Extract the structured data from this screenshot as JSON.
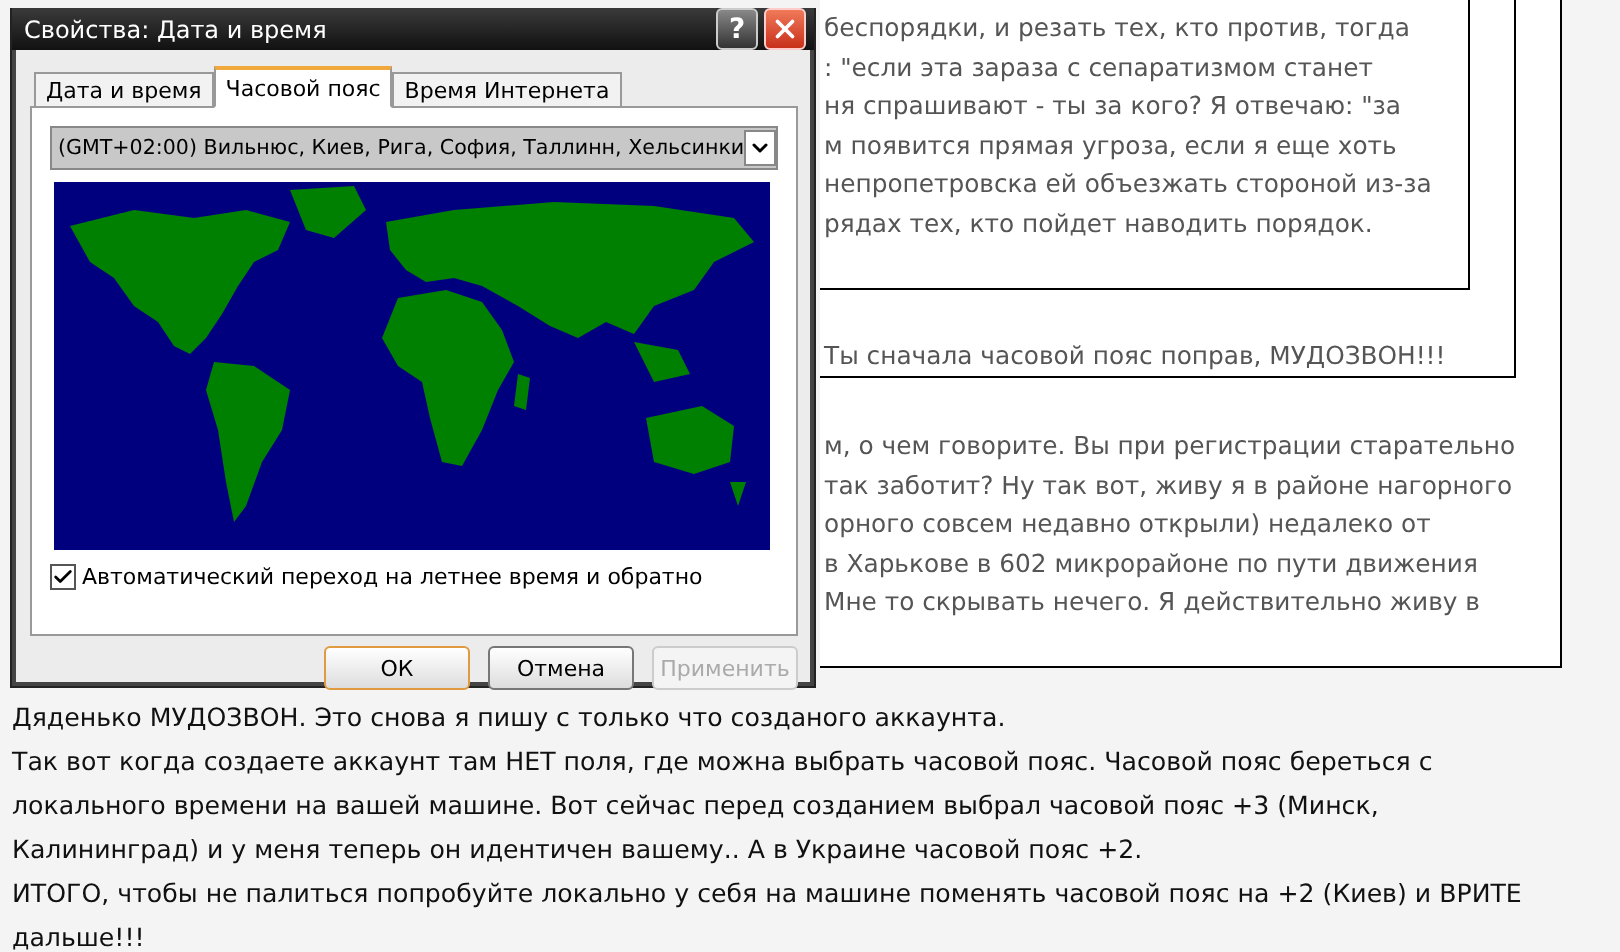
{
  "dialog": {
    "title": "Свойства: Дата и время",
    "help_button": "?",
    "tabs": [
      {
        "label": "Дата и время",
        "selected": false
      },
      {
        "label": "Часовой пояс",
        "selected": true
      },
      {
        "label": "Время Интернета",
        "selected": false
      }
    ],
    "timezone": "(GMT+02:00) Вильнюс, Киев, Рига, София, Таллинн, Хельсинки",
    "dst_checkbox": {
      "label": "Автоматический переход на летнее время и обратно",
      "checked": true
    },
    "buttons": [
      {
        "label": "ОК",
        "kind": "default",
        "disabled": false
      },
      {
        "label": "Отмена",
        "kind": "normal",
        "disabled": false
      },
      {
        "label": "Применить",
        "kind": "normal",
        "disabled": true
      }
    ]
  },
  "quote": {
    "inner_lines": [
      "беспорядки, и резать тех, кто против, тогда",
      ": \"если эта зараза с сепаратизмом станет",
      "ня спрашивают - ты за кого? Я отвечаю: \"за",
      "м появится прямая угроза, если я еще хоть",
      "непропетровска ей объезжать стороной из-за",
      "рядах тех, кто пойдет наводить порядок."
    ],
    "reply": "Ты сначала часовой пояс поправ, МУДОЗВОН!!!",
    "outer_lines": [
      "м, о чем говорите. Вы при регистрации старательно",
      "так заботит? Ну так вот, живу я в районе нагорного",
      "орного совсем недавно открыли) недалеко от",
      "в Харькове в 602 микрорайоне по пути движения",
      "Мне то скрывать нечего. Я действительно живу в"
    ]
  },
  "post": {
    "paragraphs": [
      "Дяденько МУДОЗВОН. Это снова я пишу с только что созданого аккаунта.",
      "Так вот когда создаете аккаунт там НЕТ поля, где можна выбрать часовой пояс. Часовой пояс береться с локального времени на вашей машине. Вот сейчас перед созданием выбрал часовой пояс +3 (Минск, Калининград) и у меня теперь он идентичен вашему.. А в Украине часовой пояс +2.",
      "ИТОГО, чтобы не палиться попробуйте локально у себя на машине поменять часовой пояс на +2 (Киев) и ВРИТЕ дальше!!!"
    ]
  }
}
